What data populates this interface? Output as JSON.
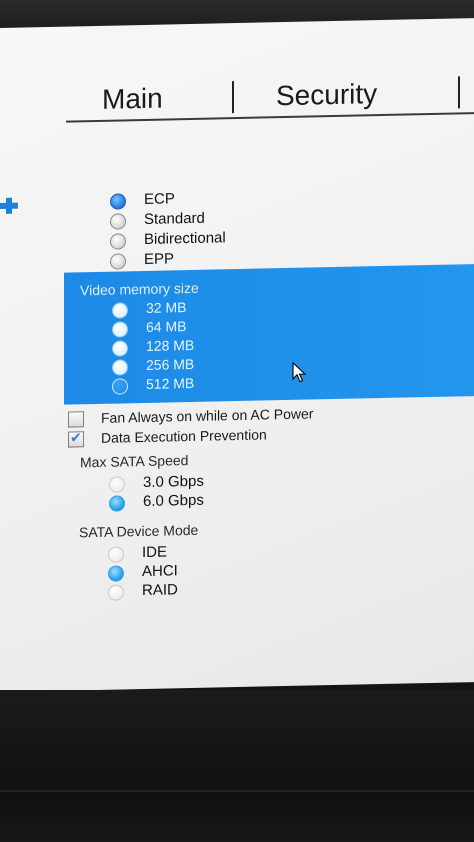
{
  "tabs": [
    {
      "label": "Main"
    },
    {
      "label": "Security"
    }
  ],
  "parallel_port": {
    "options": [
      {
        "label": "ECP",
        "selected": true
      },
      {
        "label": "Standard",
        "selected": false
      },
      {
        "label": "Bidirectional",
        "selected": false
      },
      {
        "label": "EPP",
        "selected": false
      }
    ]
  },
  "video_memory": {
    "title": "Video memory size",
    "options": [
      {
        "label": "32 MB",
        "selected": false
      },
      {
        "label": "64 MB",
        "selected": false
      },
      {
        "label": "128 MB",
        "selected": false
      },
      {
        "label": "256 MB",
        "selected": false
      },
      {
        "label": "512 MB",
        "selected": true
      }
    ]
  },
  "checkboxes": [
    {
      "label": "Fan Always on while on AC Power",
      "checked": false
    },
    {
      "label": "Data Execution Prevention",
      "checked": true
    }
  ],
  "sata_speed": {
    "title": "Max SATA Speed",
    "options": [
      {
        "label": "3.0 Gbps",
        "selected": false
      },
      {
        "label": "6.0 Gbps",
        "selected": true
      }
    ]
  },
  "sata_mode": {
    "title": "SATA Device Mode",
    "options": [
      {
        "label": "IDE",
        "selected": false
      },
      {
        "label": "AHCI",
        "selected": true
      },
      {
        "label": "RAID",
        "selected": false
      }
    ]
  },
  "colors": {
    "accent": "#2396ee",
    "selected_radio": "#2e86e8"
  },
  "icons": {
    "marker": "plus-marker-icon",
    "cursor": "mouse-pointer-icon",
    "check": "checkmark-icon"
  }
}
